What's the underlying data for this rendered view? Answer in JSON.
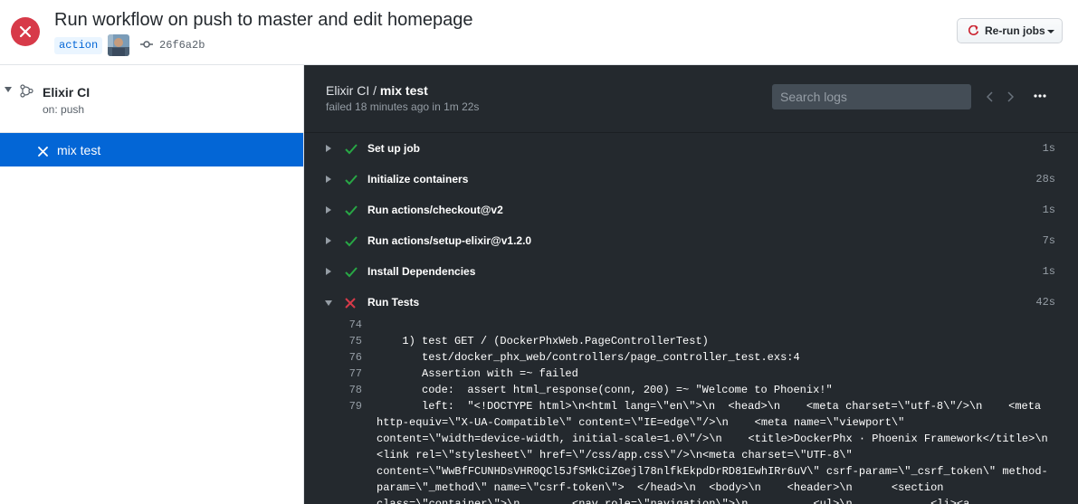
{
  "header": {
    "title": "Run workflow on push to master and edit homepage",
    "branch": "action",
    "commit_sha": "26f6a2b",
    "rerun_label": "Re-run jobs",
    "status_color": "#d73a49"
  },
  "sidebar": {
    "workflow_name": "Elixir CI",
    "trigger": "on: push",
    "jobs": [
      {
        "label": "mix test",
        "status": "failed",
        "selected": true
      }
    ]
  },
  "job": {
    "workflow": "Elixir CI / ",
    "name": "mix test",
    "status_text": "failed 18 minutes ago in 1m 22s",
    "search_placeholder": "Search logs"
  },
  "steps": [
    {
      "name": "Set up job",
      "duration": "1s",
      "status": "success"
    },
    {
      "name": "Initialize containers",
      "duration": "28s",
      "status": "success"
    },
    {
      "name": "Run actions/checkout@v2",
      "duration": "1s",
      "status": "success"
    },
    {
      "name": "Run actions/setup-elixir@v1.2.0",
      "duration": "7s",
      "status": "success"
    },
    {
      "name": "Install Dependencies",
      "duration": "1s",
      "status": "success"
    },
    {
      "name": "Run Tests",
      "duration": "42s",
      "status": "failed"
    }
  ],
  "log": {
    "lines": [
      {
        "n": "74",
        "text": ""
      },
      {
        "n": "75",
        "text": "  1) test GET / (DockerPhxWeb.PageControllerTest)"
      },
      {
        "n": "76",
        "text": "     test/docker_phx_web/controllers/page_controller_test.exs:4"
      },
      {
        "n": "77",
        "text": "     Assertion with =~ failed"
      },
      {
        "n": "78",
        "text": "     code:  assert html_response(conn, 200) =~ \"Welcome to Phoenix!\""
      },
      {
        "n": "79",
        "text": "     left:  \"<!DOCTYPE html>\\n<html lang=\\\"en\\\">\\n  <head>\\n    <meta charset=\\\"utf-8\\\"/>\\n    <meta"
      }
    ],
    "wrapped": [
      "http-equiv=\\\"X-UA-Compatible\\\" content=\\\"IE=edge\\\"/>\\n    <meta name=\\\"viewport\\\"",
      "content=\\\"width=device-width, initial-scale=1.0\\\"/>\\n    <title>DockerPhx · Phoenix Framework</title>\\n",
      "<link rel=\\\"stylesheet\\\" href=\\\"/css/app.css\\\"/>\\n<meta charset=\\\"UTF-8\\\"",
      "content=\\\"WwBfFCUNHDsVHR0QCl5JfSMkCiZGejl78nlfkEkpdDrRD81EwhIRr6uV\\\" csrf-param=\\\"_csrf_token\\\" method-",
      "param=\\\"_method\\\" name=\\\"csrf-token\\\">  </head>\\n  <body>\\n    <header>\\n      <section",
      "class=\\\"container\\\">\\n        <nav role=\\\"navigation\\\">\\n          <ul>\\n            <li><a"
    ]
  },
  "colors": {
    "success": "#28a745",
    "failure": "#d73a49",
    "accent": "#0366d6",
    "log_bg": "#24292e"
  }
}
